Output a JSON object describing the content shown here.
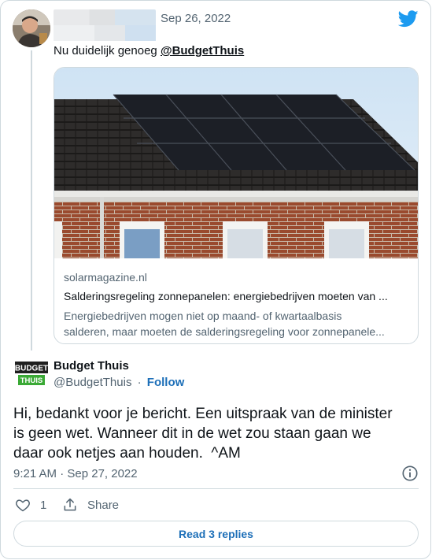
{
  "parent_tweet": {
    "date": "Sep 26, 2022",
    "reply_prefix": "Nu duidelijk genoeg",
    "reply_mention": "@BudgetThuis",
    "link_card": {
      "domain": "solarmagazine.nl",
      "title": "Salderingsregeling zonnepanelen: energiebedrijven moeten van ...",
      "description_line1": "Energiebedrijven mogen niet op maand- of kwartaalbasis",
      "description_line2": "salderen, maar moeten de salderingsregeling voor zonnepanele..."
    }
  },
  "main_tweet": {
    "author_name": "Budget Thuis",
    "author_handle": "@BudgetThuis",
    "separator": "·",
    "follow_label": "Follow",
    "logo_text_top": "BUDGET",
    "logo_text_bottom": "THUIS",
    "body": "Hi, bedankt voor je bericht. Een uitspraak van de minister\nis geen wet. Wanneer dit in de wet zou staan gaan we\ndaar ook netjes aan houden.  ^AM",
    "timestamp": "9:21 AM · Sep 27, 2022",
    "like_count": "1",
    "share_label": "Share",
    "read_replies_label": "Read 3 replies"
  },
  "icons": {
    "brand": "twitter-bird-icon",
    "info": "info-icon",
    "like": "heart-icon",
    "share": "share-icon"
  },
  "colors": {
    "twitter_blue": "#1d9bf0",
    "link_blue": "#1d6fb8",
    "border": "#cfd9de",
    "muted_text": "#536471",
    "logo_green": "#3aa935"
  }
}
